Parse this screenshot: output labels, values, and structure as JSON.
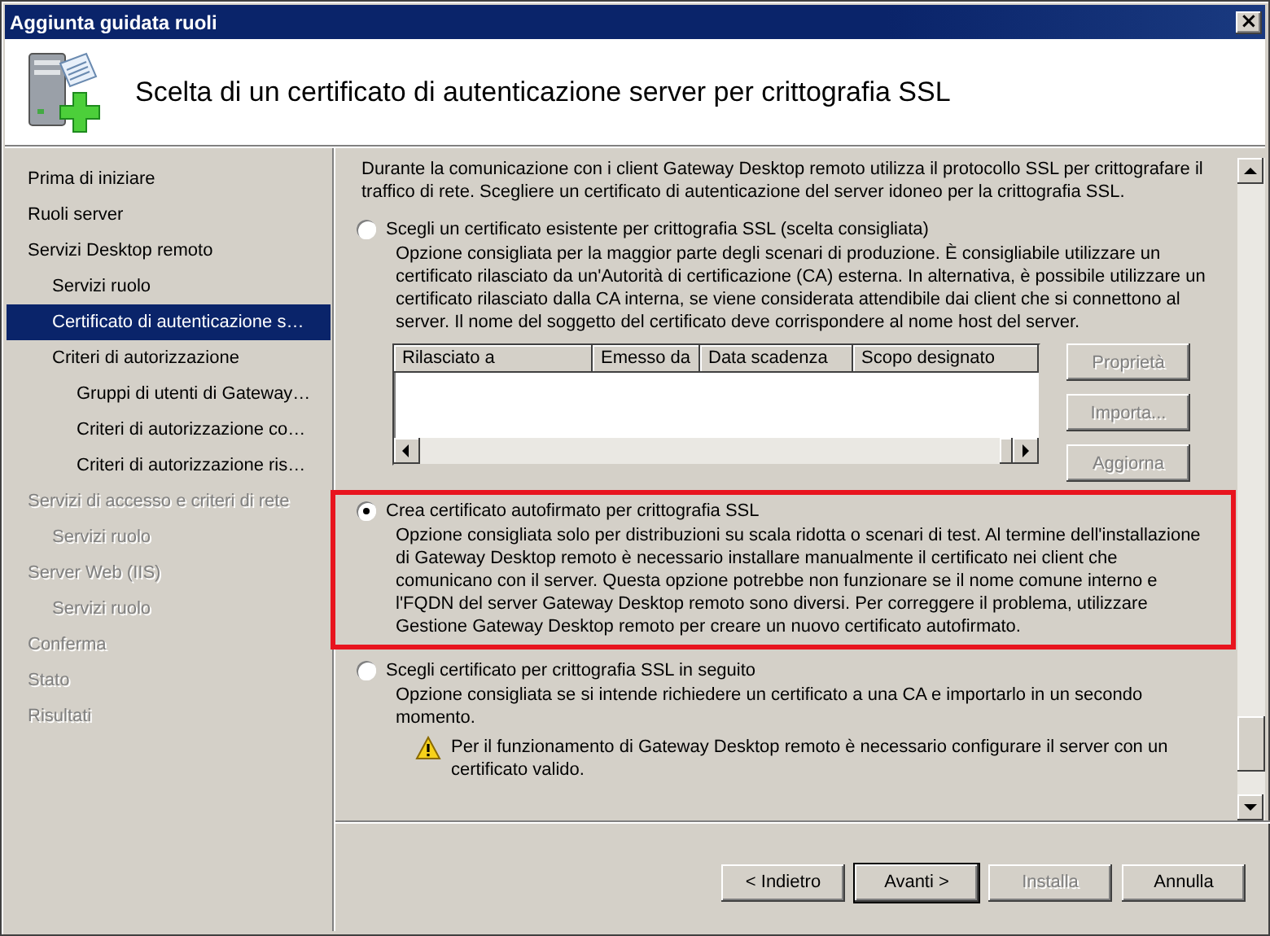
{
  "window": {
    "title": "Aggiunta guidata ruoli",
    "close": "×"
  },
  "header": {
    "title": "Scelta di un certificato di autenticazione server per crittografia SSL"
  },
  "sidebar": {
    "items": [
      {
        "label": "Prima di iniziare",
        "selected": false,
        "disabled": false
      },
      {
        "label": "Ruoli server",
        "selected": false,
        "disabled": false
      },
      {
        "label": "Servizi Desktop remoto",
        "selected": false,
        "disabled": false,
        "children": [
          {
            "label": "Servizi ruolo",
            "selected": false,
            "disabled": false
          },
          {
            "label": "Certificato di autenticazione s…",
            "selected": true,
            "disabled": false
          },
          {
            "label": "Criteri di autorizzazione",
            "selected": false,
            "disabled": false,
            "children": [
              {
                "label": "Gruppi di utenti di Gateway…",
                "selected": false,
                "disabled": false
              },
              {
                "label": "Criteri di autorizzazione co…",
                "selected": false,
                "disabled": false
              },
              {
                "label": "Criteri di autorizzazione ris…",
                "selected": false,
                "disabled": false
              }
            ]
          }
        ]
      },
      {
        "label": "Servizi di accesso e criteri di rete",
        "selected": false,
        "disabled": true,
        "children": [
          {
            "label": "Servizi ruolo",
            "selected": false,
            "disabled": true
          }
        ]
      },
      {
        "label": "Server Web (IIS)",
        "selected": false,
        "disabled": true,
        "children": [
          {
            "label": "Servizi ruolo",
            "selected": false,
            "disabled": true
          }
        ]
      },
      {
        "label": "Conferma",
        "selected": false,
        "disabled": true
      },
      {
        "label": "Stato",
        "selected": false,
        "disabled": true
      },
      {
        "label": "Risultati",
        "selected": false,
        "disabled": true
      }
    ]
  },
  "content": {
    "intro": "Durante la comunicazione con i client Gateway Desktop remoto utilizza il protocollo SSL per crittografare il traffico di rete. Scegliere un certificato di autenticazione del server idoneo per la crittografia SSL.",
    "options": [
      {
        "label": "Scegli un certificato esistente per crittografia SSL (scelta consigliata)",
        "selected": false,
        "highlighted": false,
        "description": "Opzione consigliata per la maggior parte degli scenari di produzione. È consigliabile utilizzare un certificato rilasciato da un'Autorità di certificazione (CA) esterna. In alternativa, è possibile utilizzare un certificato rilasciato dalla CA interna, se viene considerata attendibile dai client che si connettono al server. Il nome del soggetto del certificato deve corrispondere al nome host del server.",
        "table": {
          "columns": [
            "Rilasciato a",
            "Emesso da",
            "Data scadenza",
            "Scopo designato"
          ]
        },
        "buttons": [
          {
            "label": "Proprietà",
            "disabled": true
          },
          {
            "label": "Importa...",
            "disabled": true
          },
          {
            "label": "Aggiorna",
            "disabled": true
          }
        ]
      },
      {
        "label": "Crea certificato autofirmato per crittografia SSL",
        "selected": true,
        "highlighted": true,
        "description": "Opzione consigliata solo per distribuzioni su scala ridotta o scenari di test. Al termine dell'installazione di Gateway Desktop remoto è necessario installare manualmente il certificato nei client che comunicano con il server. Questa opzione potrebbe non funzionare se il nome comune interno e l'FQDN del server Gateway Desktop remoto sono diversi. Per correggere il problema, utilizzare Gestione Gateway Desktop remoto per creare un nuovo certificato autofirmato."
      },
      {
        "label": "Scegli certificato per crittografia SSL in seguito",
        "selected": false,
        "highlighted": false,
        "description": "Opzione consigliata se si intende richiedere un certificato a una CA e importarlo in un secondo momento.",
        "warning": "Per il funzionamento di Gateway Desktop remoto è necessario configurare il server con un certificato valido."
      }
    ]
  },
  "buttons": [
    {
      "label": "< Indietro",
      "disabled": false,
      "default": false
    },
    {
      "label": "Avanti >",
      "disabled": false,
      "default": true
    },
    {
      "label": "Installa",
      "disabled": true,
      "default": false
    },
    {
      "label": "Annulla",
      "disabled": false,
      "default": false
    }
  ]
}
